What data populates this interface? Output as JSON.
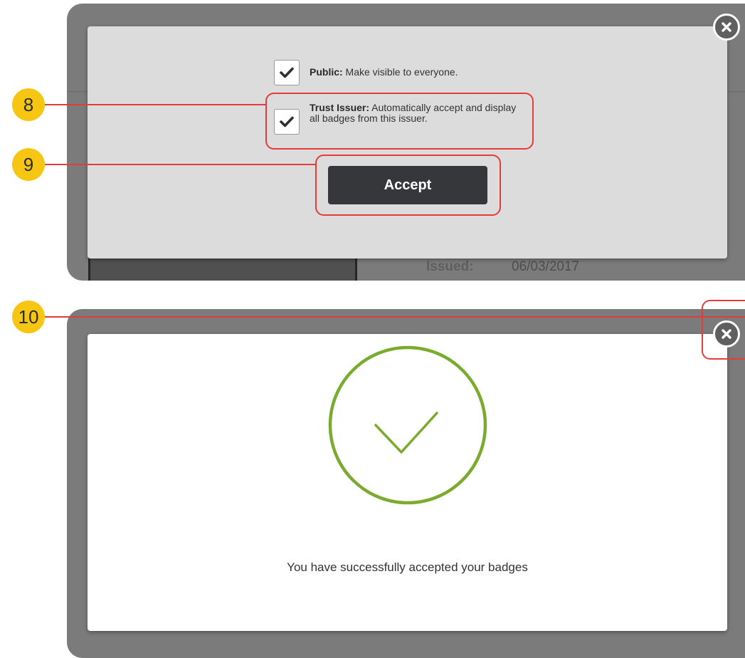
{
  "top_panel": {
    "background_issued_label": "Issued:",
    "background_issued_value": "06/03/2017",
    "public_option": {
      "label_bold": "Public:",
      "label_text": " Make visible to everyone.",
      "checked": true
    },
    "trust_option": {
      "label_bold": "Trust Issuer:",
      "label_text": " Automatically accept and display all badges from this issuer.",
      "checked": true
    },
    "accept_button": "Accept",
    "close_icon": "close-circle-icon"
  },
  "bottom_panel": {
    "success_icon": "check-circle-icon",
    "success_message": "You have successfully accepted your badges",
    "close_icon": "close-circle-icon"
  },
  "callouts": [
    {
      "number": "8"
    },
    {
      "number": "9"
    },
    {
      "number": "10"
    }
  ],
  "colors": {
    "callout_fill": "#f7c613",
    "callout_line": "#e53b3b",
    "success_green": "#7aab2f",
    "accept_button": "#36373b"
  }
}
